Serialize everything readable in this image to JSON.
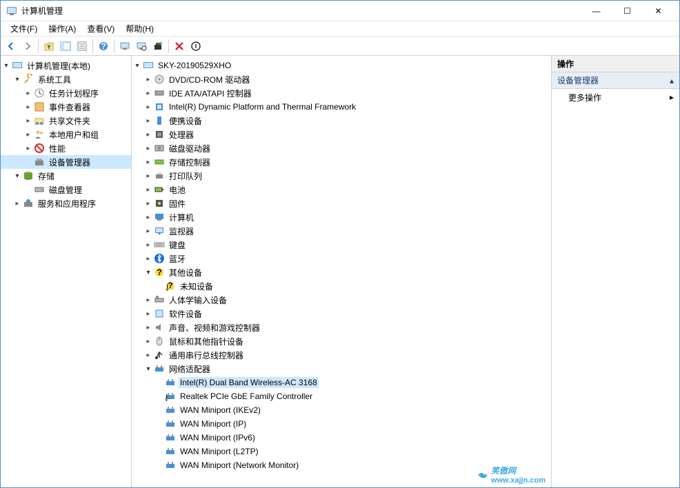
{
  "window": {
    "title": "计算机管理",
    "controls": {
      "min": "—",
      "max": "☐",
      "close": "✕"
    }
  },
  "menu": {
    "file": "文件(F)",
    "action": "操作(A)",
    "view": "查看(V)",
    "help": "帮助(H)"
  },
  "left_tree": {
    "root": "计算机管理(本地)",
    "system_tools": "系统工具",
    "task_scheduler": "任务计划程序",
    "event_viewer": "事件查看器",
    "shared_folders": "共享文件夹",
    "local_users": "本地用户和组",
    "performance": "性能",
    "device_manager": "设备管理器",
    "storage": "存储",
    "disk_mgmt": "磁盘管理",
    "services": "服务和应用程序"
  },
  "center": {
    "root": "SKY-20190529XHO",
    "items": [
      {
        "label": "DVD/CD-ROM 驱动器",
        "icon": "disc"
      },
      {
        "label": "IDE ATA/ATAPI 控制器",
        "icon": "ide"
      },
      {
        "label": "Intel(R) Dynamic Platform and Thermal Framework",
        "icon": "chip"
      },
      {
        "label": "便携设备",
        "icon": "portable"
      },
      {
        "label": "处理器",
        "icon": "cpu"
      },
      {
        "label": "磁盘驱动器",
        "icon": "hdd"
      },
      {
        "label": "存储控制器",
        "icon": "storage"
      },
      {
        "label": "打印队列",
        "icon": "printer"
      },
      {
        "label": "电池",
        "icon": "battery"
      },
      {
        "label": "固件",
        "icon": "firmware"
      },
      {
        "label": "计算机",
        "icon": "computer"
      },
      {
        "label": "监视器",
        "icon": "monitor"
      },
      {
        "label": "键盘",
        "icon": "keyboard"
      },
      {
        "label": "蓝牙",
        "icon": "bluetooth"
      }
    ],
    "other_devices": {
      "label": "其他设备",
      "child": "未知设备"
    },
    "items2": [
      {
        "label": "人体学输入设备",
        "icon": "hid"
      },
      {
        "label": "软件设备",
        "icon": "software"
      },
      {
        "label": "声音、视频和游戏控制器",
        "icon": "audio"
      },
      {
        "label": "鼠标和其他指针设备",
        "icon": "mouse"
      },
      {
        "label": "通用串行总线控制器",
        "icon": "usb"
      }
    ],
    "network": {
      "label": "网络适配器",
      "children": [
        "Intel(R) Dual Band Wireless-AC 3168",
        "Realtek PCIe GbE Family Controller",
        "WAN Miniport (IKEv2)",
        "WAN Miniport (IP)",
        "WAN Miniport (IPv6)",
        "WAN Miniport (L2TP)",
        "WAN Miniport (Network Monitor)"
      ],
      "selected_index": 0,
      "warning_index": 1
    }
  },
  "right": {
    "header": "操作",
    "section": "设备管理器",
    "more_actions": "更多操作"
  },
  "watermark": {
    "text": "笑傲网",
    "url": "www.xajjn.com"
  }
}
